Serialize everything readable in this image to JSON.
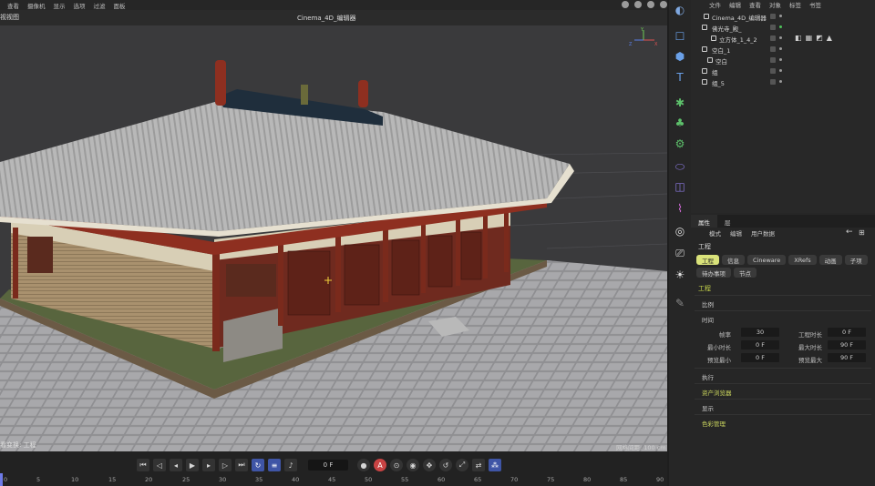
{
  "menu": {
    "items": [
      "查看",
      "摄像机",
      "显示",
      "选项",
      "过滤",
      "面板"
    ]
  },
  "viewport": {
    "label": "视视图",
    "title": "Cinema_4D_编辑器",
    "status": "看变换: 工程",
    "grid_label": "网格间距: 100 cm",
    "axis": {
      "y": "Y",
      "x": "X",
      "z": "Z"
    }
  },
  "timeline": {
    "frame_value": "0 F",
    "ruler_ticks": [
      "0",
      "5",
      "10",
      "15",
      "20",
      "25",
      "30",
      "35",
      "40",
      "45",
      "50",
      "55",
      "60",
      "65",
      "70",
      "75",
      "80",
      "85",
      "90"
    ]
  },
  "object_manager": {
    "menu": [
      "文件",
      "编辑",
      "查看",
      "对象",
      "标签",
      "书签"
    ],
    "rows": [
      {
        "name": "Cinema_4D_编辑器"
      },
      {
        "name": "佛光寺_殿_"
      },
      {
        "name": "立方体_1_4_2"
      },
      {
        "name": "空白_1"
      },
      {
        "name": "空白"
      },
      {
        "name": "组"
      },
      {
        "name": "组_5"
      }
    ]
  },
  "attributes": {
    "tabs": [
      "属性",
      "层"
    ],
    "menu": [
      "模式",
      "编辑",
      "用户数据"
    ],
    "header": "工程",
    "subtabs": [
      "工程",
      "信息",
      "Cineware",
      "XRefs",
      "动画",
      "子项",
      "待办事项",
      "节点"
    ],
    "section_title": "工程",
    "groups": {
      "ratio": "比例",
      "time": "时间",
      "execute": "执行",
      "asset_browser": "资产浏览器",
      "display": "显示",
      "color_mgmt": "色彩管理"
    },
    "fields": {
      "fps_label": "帧率",
      "fps_value": "30",
      "proj_len_label": "工程时长",
      "proj_len_value": "0 F",
      "min_len_label": "最小时长",
      "min_len_value": "0 F",
      "max_len_label": "最大时长",
      "max_len_value": "90 F",
      "prev_min_label": "预览最小",
      "prev_min_value": "0 F",
      "prev_max_label": "预览最大",
      "prev_max_value": "90 F"
    }
  },
  "colors": {
    "accent_blue": "#3f55a6",
    "tab_active": "#d9e27a",
    "section_yellow": "#c9d84a",
    "record_red": "#c84343"
  }
}
